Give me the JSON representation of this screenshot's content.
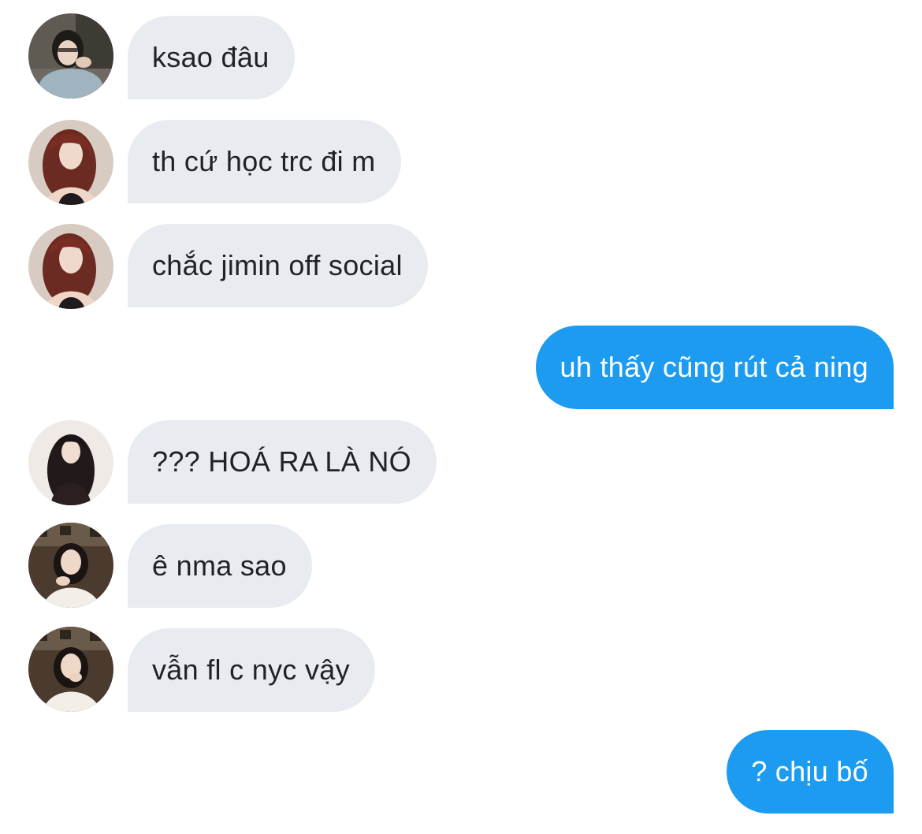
{
  "colors": {
    "incoming_bubble": "#e8ecf0",
    "incoming_text": "#1f2328",
    "outgoing_bubble": "#1d9bf0",
    "outgoing_text": "#ffffff",
    "background": "#ffffff"
  },
  "messages": [
    {
      "direction": "incoming",
      "text": "ksao đâu",
      "avatar": "avatar-photo-1"
    },
    {
      "direction": "incoming",
      "text": "th cứ học trc đi m",
      "avatar": "avatar-photo-2"
    },
    {
      "direction": "incoming",
      "text": "chắc jimin off social",
      "avatar": "avatar-photo-2"
    },
    {
      "direction": "outgoing",
      "text": "uh thấy cũng rút cả ning"
    },
    {
      "direction": "incoming",
      "text": "??? HOÁ RA LÀ NÓ",
      "avatar": "avatar-photo-3"
    },
    {
      "direction": "incoming",
      "text": "ê nma sao",
      "avatar": "avatar-photo-4"
    },
    {
      "direction": "incoming",
      "text": "vẫn fl c nyc vậy",
      "avatar": "avatar-photo-4"
    },
    {
      "direction": "outgoing",
      "text": "? chịu bố"
    }
  ]
}
